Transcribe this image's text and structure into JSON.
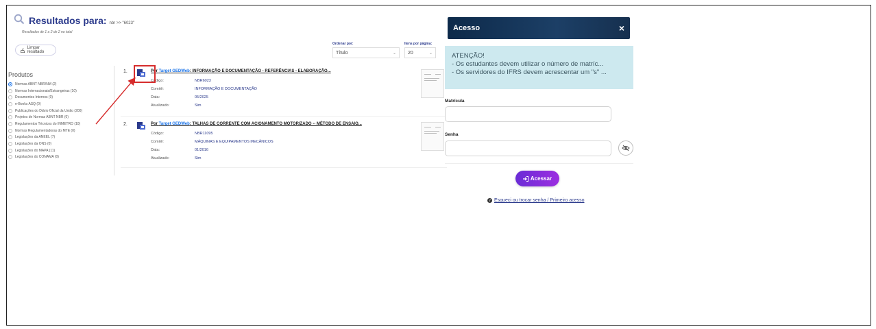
{
  "header": {
    "title": "Resultados para:",
    "query": "nbr >> \"6023\"",
    "subtitle": "Resultados de 1 a 2 de 2 no total"
  },
  "toolbar": {
    "clear_label": "Limpar resultado",
    "sort_label": "Ordenar por:",
    "sort_value": "Título",
    "per_page_label": "Itens por página:",
    "per_page_value": "20"
  },
  "sidebar": {
    "title": "Produtos",
    "options": [
      {
        "label": "Normas ABNT NBR/NM (2)",
        "selected": true
      },
      {
        "label": "Normas Internacionais/Estrangeiras (10)",
        "selected": false
      },
      {
        "label": "Documentos Internos (0)",
        "selected": false
      },
      {
        "label": "e-Books ASQ (0)",
        "selected": false
      },
      {
        "label": "Publicações do Diário Oficial da União (200)",
        "selected": false
      },
      {
        "label": "Projetos de Normas ABNT NBR (0)",
        "selected": false
      },
      {
        "label": "Regulamentos Técnicos do INMETRO (10)",
        "selected": false
      },
      {
        "label": "Normas Regulamentadoras do MTE (0)",
        "selected": false
      },
      {
        "label": "Legislações da ANEEL (7)",
        "selected": false
      },
      {
        "label": "Legislações da ONS (0)",
        "selected": false
      },
      {
        "label": "Legislações do MAPA (11)",
        "selected": false
      },
      {
        "label": "Legislações do CONAMA (0)",
        "selected": false
      }
    ]
  },
  "results": [
    {
      "number": "1.",
      "prefix": "Por ",
      "brand": "Target GEDWeb",
      "title": ": INFORMAÇÃO E DOCUMENTAÇÃO - REFERÊNCIAS - ELABORAÇÃO...",
      "fields": [
        {
          "key": "Código:",
          "value": "NBR6023"
        },
        {
          "key": "Comitê:",
          "value": "INFORMAÇÃO E DOCUMENTAÇÃO"
        },
        {
          "key": "Data:",
          "value": "05/2025"
        },
        {
          "key": "Atualizado:",
          "value": "Sim"
        }
      ]
    },
    {
      "number": "2.",
      "prefix": "Por ",
      "brand": "Target GEDWeb",
      "title": ": TALHAS DE CORRENTE COM ACIONAMENTO MOTORIZADO -- MÉTODO DE ENSAIO...",
      "fields": [
        {
          "key": "Código:",
          "value": "NBR11095"
        },
        {
          "key": "Comitê:",
          "value": "MÁQUINAS E EQUIPAMENTOS MECÂNICOS"
        },
        {
          "key": "Data:",
          "value": "01/2016"
        },
        {
          "key": "Atualizado:",
          "value": "Sim"
        }
      ]
    }
  ],
  "login": {
    "title": "Acesso",
    "close": "×",
    "notice_title": "ATENÇÃO!",
    "notice_line1": "- Os estudantes devem utilizar o número de matríc...",
    "notice_line2": "- Os servidores do IFRS devem acrescentar um \"s\" ...",
    "matricula_label": "Matrícula",
    "senha_label": "Senha",
    "submit": "Acessar",
    "forgot": "Esqueci ou trocar senha / Primeiro acesso"
  },
  "colors": {
    "accent": "#2b3a8c",
    "link": "#1a73e8",
    "highlight": "#d62c2c",
    "button": "#7b2bd9",
    "notice_bg": "#cde9ef"
  }
}
